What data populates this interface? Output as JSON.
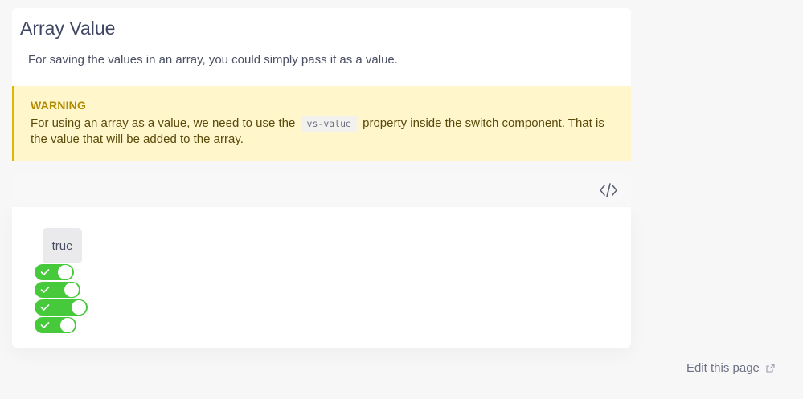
{
  "section": {
    "title": "Array Value",
    "intro": "For saving the values in an array, you could simply pass it as a value."
  },
  "warning": {
    "title": "WARNING",
    "text_before": "For using an array as a value, we need to use the",
    "code": "vs-value",
    "text_after": "property inside the switch component. That is the value that will be added to the array."
  },
  "demo": {
    "value_display": "true",
    "switches": [
      {
        "name": "switch-1",
        "checked": true
      },
      {
        "name": "switch-2",
        "checked": true
      },
      {
        "name": "switch-3",
        "checked": true
      },
      {
        "name": "switch-4",
        "checked": true
      }
    ],
    "code_toggle_icon": "code-icon",
    "switch_color": "#46c93a"
  },
  "footer": {
    "edit_label": "Edit this page",
    "edit_icon": "external-link-icon"
  }
}
